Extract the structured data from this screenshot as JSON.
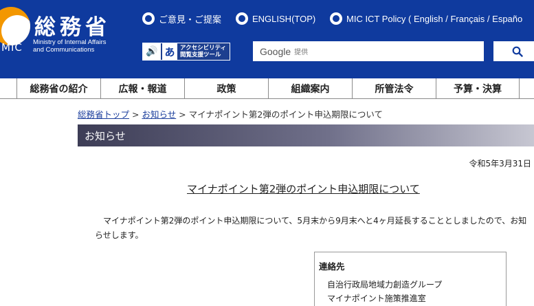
{
  "header": {
    "org_name": "総務省",
    "org_abbr": "MIC",
    "org_en_line1": "Ministry of Internal Affairs",
    "org_en_line2": "and Communications",
    "links": [
      {
        "label": "ご意見・ご提案"
      },
      {
        "label": "ENGLISH(TOP)"
      },
      {
        "label": "MIC ICT Policy ( English / Français / Españo"
      }
    ],
    "accessibility_tool": {
      "line1": "アクセシビリティ",
      "line2": "閲覧支援ツール"
    },
    "search": {
      "logo": "Google",
      "sub": "提供"
    },
    "colors": {
      "header_bg": "#0f3a9e",
      "logo_orange": "#f39700"
    }
  },
  "nav": {
    "items": [
      {
        "label": "総務省の紹介"
      },
      {
        "label": "広報・報道"
      },
      {
        "label": "政策"
      },
      {
        "label": "組織案内"
      },
      {
        "label": "所管法令"
      },
      {
        "label": "予算・決算"
      }
    ]
  },
  "breadcrumb": {
    "home": "総務省トップ",
    "sep1": " > ",
    "section": "お知らせ",
    "sep2": " > ",
    "current": "マイナポイント第2弾のポイント申込期限について"
  },
  "section_title": "お知らせ",
  "article": {
    "date": "令和5年3月31日",
    "title": "マイナポイント第2弾のポイント申込期限について",
    "body": "マイナポイント第2弾のポイント申込期限について、5月末から9月末へと4ヶ月延長することとしましたので、お知らせします。"
  },
  "contact": {
    "heading": "連絡先",
    "lines": [
      "自治行政局地域力創造グループ",
      "マイナポイント施策推進室"
    ]
  }
}
